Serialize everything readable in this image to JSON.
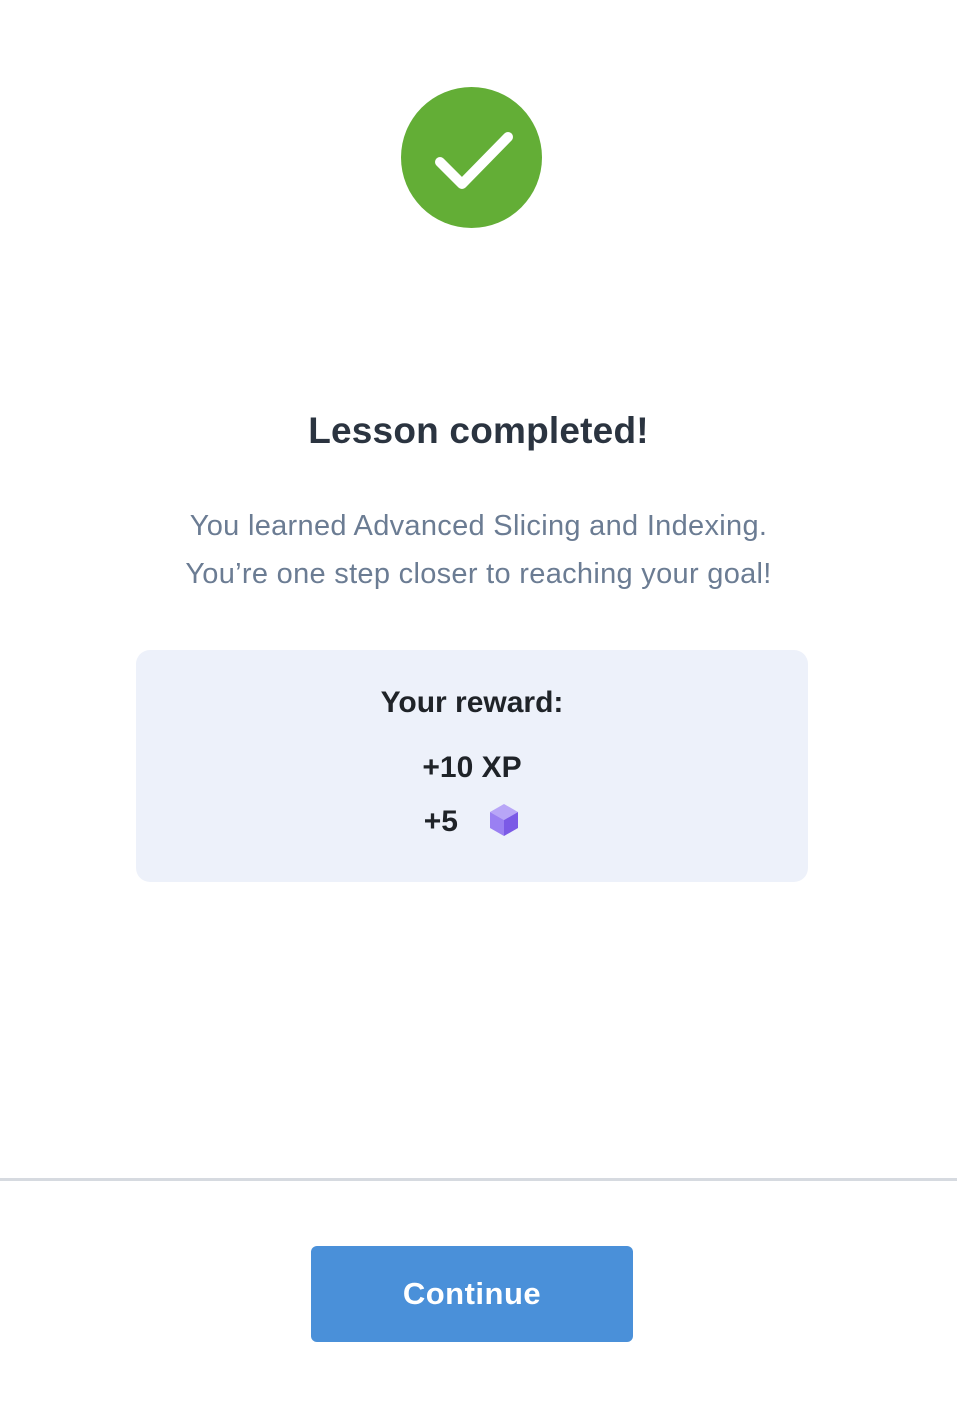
{
  "colors": {
    "success": "#63ae36",
    "primary": "#4a90d9",
    "card_background": "#edf1fa",
    "gem": "#8b6cf0"
  },
  "status": {
    "icon": "checkmark-icon",
    "title": "Lesson completed!",
    "message_line1": "You learned Advanced Slicing and Indexing.",
    "message_line2": "You’re one step closer to reaching your goal!"
  },
  "reward": {
    "heading": "Your reward:",
    "xp": "+10 XP",
    "gems": "+5",
    "gem_icon": "gem-cube-icon"
  },
  "footer": {
    "continue_label": "Continue"
  }
}
